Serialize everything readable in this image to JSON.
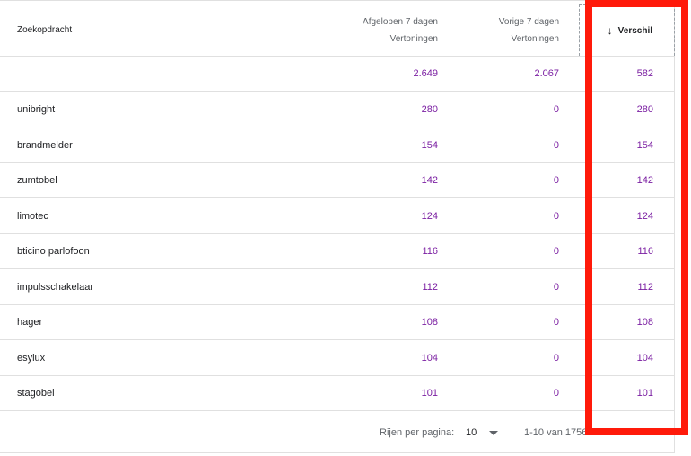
{
  "table": {
    "headers": {
      "query": "Zoekopdracht",
      "col1_line1": "Afgelopen 7 dagen",
      "col1_line2": "Vertoningen",
      "col2_line1": "Vorige 7 dagen",
      "col2_line2": "Vertoningen",
      "diff": "Verschil"
    },
    "totals": {
      "col1": "2.649",
      "col2": "2.067",
      "diff": "582"
    },
    "rows": [
      {
        "query": "unibright",
        "col1": "280",
        "col2": "0",
        "diff": "280"
      },
      {
        "query": "brandmelder",
        "col1": "154",
        "col2": "0",
        "diff": "154"
      },
      {
        "query": "zumtobel",
        "col1": "142",
        "col2": "0",
        "diff": "142"
      },
      {
        "query": "limotec",
        "col1": "124",
        "col2": "0",
        "diff": "124"
      },
      {
        "query": "bticino parlofoon",
        "col1": "116",
        "col2": "0",
        "diff": "116"
      },
      {
        "query": "impulsschakelaar",
        "col1": "112",
        "col2": "0",
        "diff": "112"
      },
      {
        "query": "hager",
        "col1": "108",
        "col2": "0",
        "diff": "108"
      },
      {
        "query": "esylux",
        "col1": "104",
        "col2": "0",
        "diff": "104"
      },
      {
        "query": "stagobel",
        "col1": "101",
        "col2": "0",
        "diff": "101"
      }
    ]
  },
  "footer": {
    "rows_per_page_label": "Rijen per pagina:",
    "rows_per_page_value": "10",
    "range_text": "1-10 van 1756"
  },
  "colors": {
    "value": "#7b1fa2",
    "highlight": "#ff1a0a"
  },
  "icons": {
    "sort": "arrow-down-icon",
    "dropdown": "caret-down-icon"
  }
}
